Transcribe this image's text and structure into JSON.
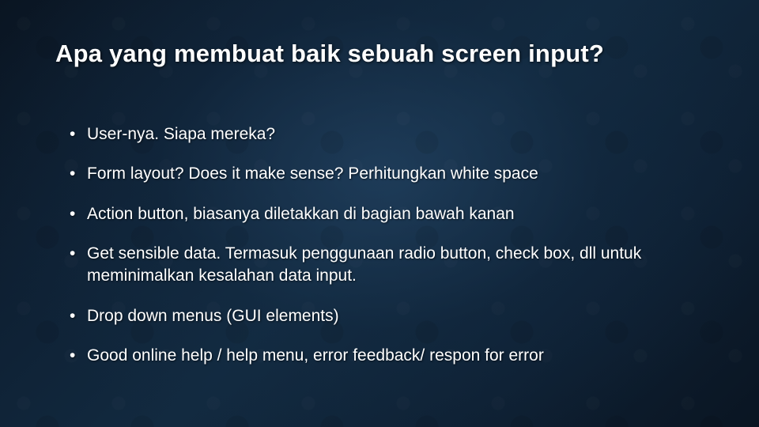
{
  "slide": {
    "title": "Apa yang membuat baik sebuah screen input?",
    "bullets": [
      "User-nya. Siapa mereka?",
      "Form layout? Does it make sense? Perhitungkan white space",
      "Action button, biasanya diletakkan di bagian bawah kanan",
      "Get sensible data. Termasuk penggunaan radio button, check box, dll untuk meminimalkan kesalahan data input.",
      "Drop down menus (GUI elements)",
      "Good online help / help menu, error feedback/ respon for error"
    ]
  }
}
